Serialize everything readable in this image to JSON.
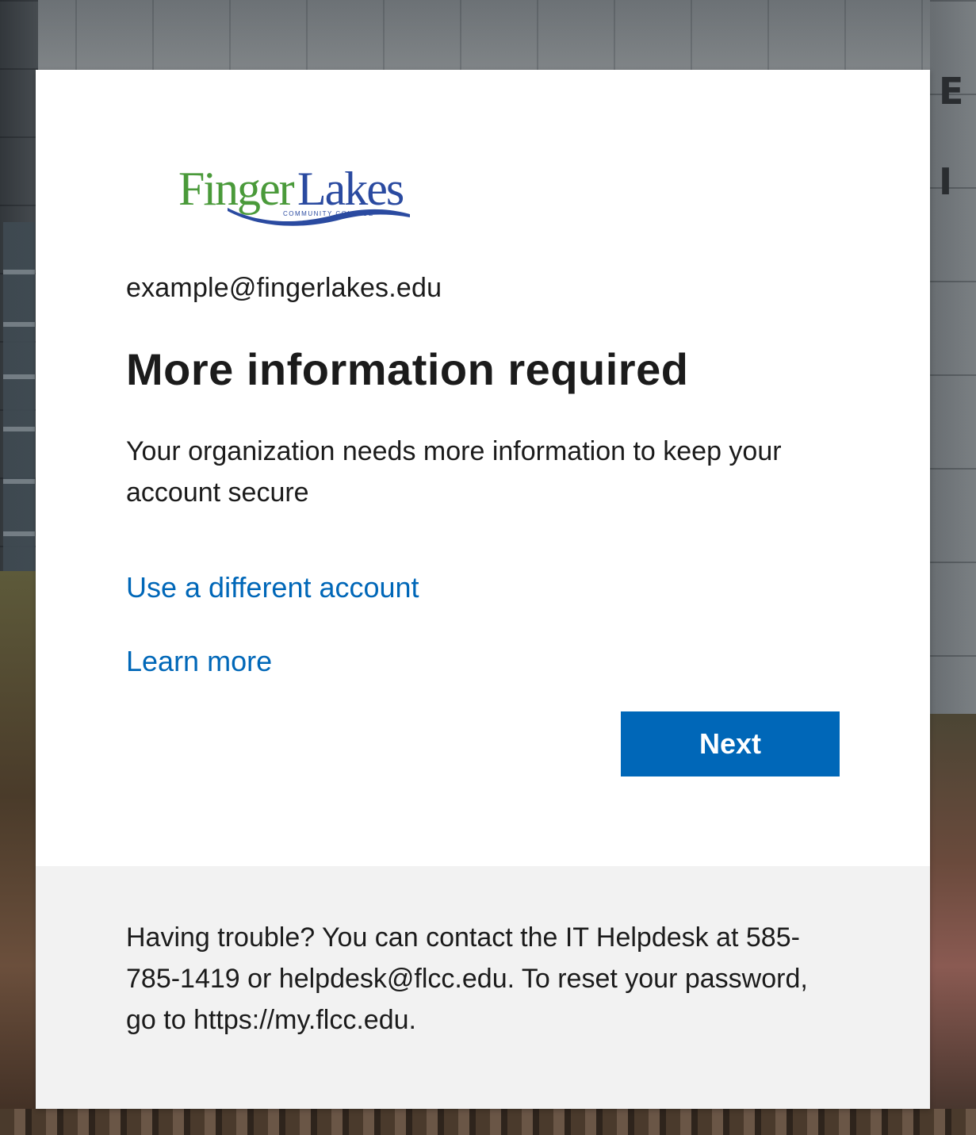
{
  "organization": {
    "logo_text_finger": "Finger",
    "logo_text_lakes": "Lakes",
    "logo_subtext": "COMMUNITY COLLEGE"
  },
  "background": {
    "sign_letters": [
      "E",
      "I"
    ]
  },
  "signin": {
    "email": "example@fingerlakes.edu",
    "title": "More information required",
    "description": "Your organization needs more information to keep your account secure",
    "link_different_account": "Use a different account",
    "link_learn_more": "Learn more",
    "next_label": "Next"
  },
  "footer": {
    "help_text": "Having trouble? You can contact the IT Helpdesk at 585-785-1419 or helpdesk@flcc.edu. To reset your password, go to https://my.flcc.edu."
  },
  "colors": {
    "accent": "#0067b8",
    "logo_green": "#4a9a3a",
    "logo_blue": "#2a4aa0",
    "footer_bg": "#f2f2f2"
  }
}
